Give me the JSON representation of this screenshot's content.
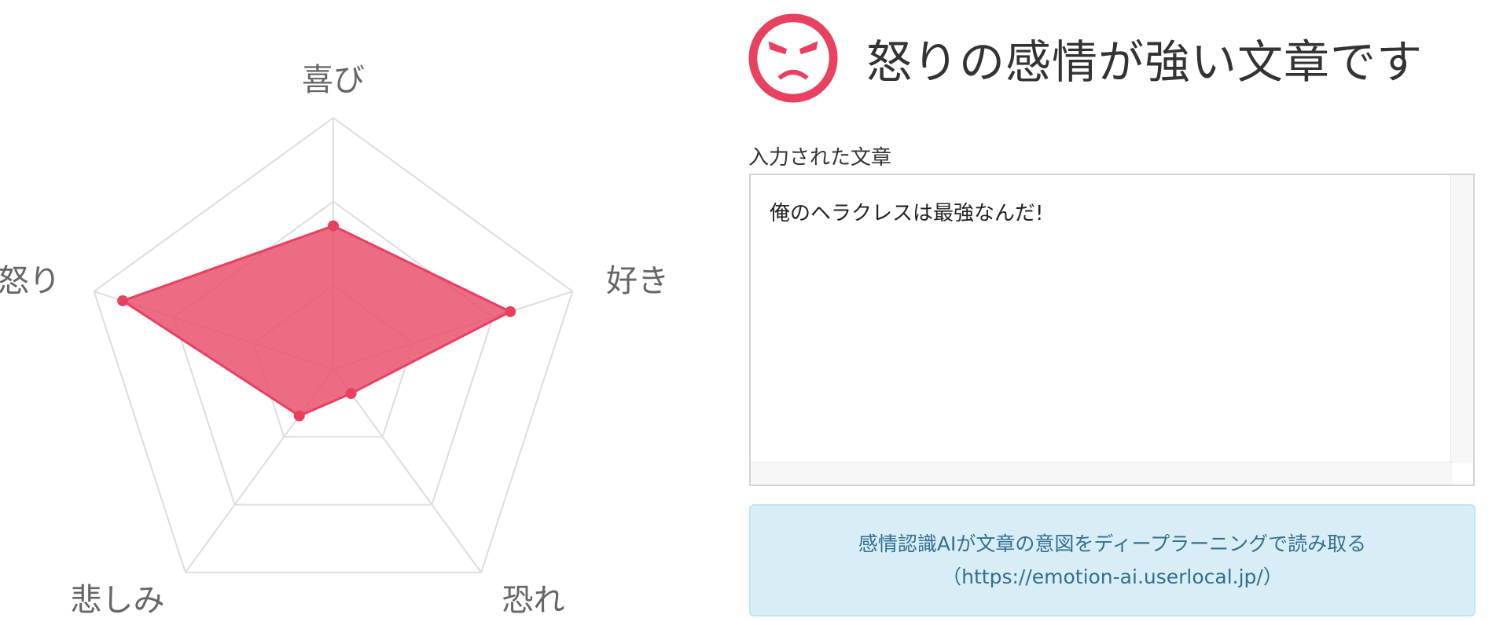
{
  "chart_data": {
    "type": "radar",
    "axes": [
      "喜び",
      "好き",
      "恐れ",
      "悲しみ",
      "怒り"
    ],
    "series": [
      {
        "values": [
          0.57,
          0.74,
          0.12,
          0.23,
          0.88
        ]
      }
    ],
    "range": [
      0,
      1
    ],
    "grid_levels": 3,
    "colors": {
      "fill": "#e8526e",
      "fill_opacity": 0.85,
      "stroke": "#e8405f",
      "grid": "#dddddd",
      "label": "#666666"
    }
  },
  "result": {
    "icon": "angry-face-icon",
    "icon_color": "#e8405f",
    "title": "怒りの感情が強い文章です"
  },
  "input": {
    "label": "入力された文章",
    "text": "俺のヘラクレスは最強なんだ!"
  },
  "info": {
    "line1": "感情認識AIが文章の意図をディープラーニングで読み取る",
    "line2": "（https://emotion-ai.userlocal.jp/）"
  }
}
